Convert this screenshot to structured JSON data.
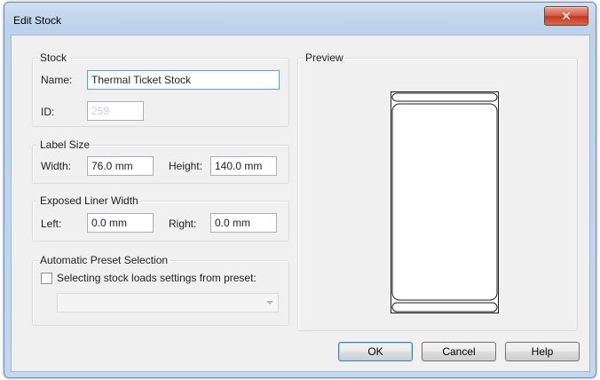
{
  "window": {
    "title": "Edit Stock",
    "close_glyph": "✕"
  },
  "stock": {
    "group_title": "Stock",
    "name_label": "Name:",
    "name_value": "Thermal Ticket Stock",
    "id_label": "ID:",
    "id_value": "259"
  },
  "label_size": {
    "group_title": "Label Size",
    "width_label": "Width:",
    "width_value": "76.0 mm",
    "height_label": "Height:",
    "height_value": "140.0 mm"
  },
  "liner": {
    "group_title": "Exposed Liner Width",
    "left_label": "Left:",
    "left_value": "0.0 mm",
    "right_label": "Right:",
    "right_value": "0.0 mm"
  },
  "preset": {
    "group_title": "Automatic Preset Selection",
    "checkbox_label": "Selecting stock loads settings from preset:",
    "checked": false,
    "selected_value": ""
  },
  "preview": {
    "group_title": "Preview"
  },
  "buttons": {
    "ok": "OK",
    "cancel": "Cancel",
    "help": "Help"
  },
  "colors": {
    "title_bar": "#c4d7ec",
    "close_button": "#c2381f",
    "dialog_bg": "#f0f0f0"
  }
}
